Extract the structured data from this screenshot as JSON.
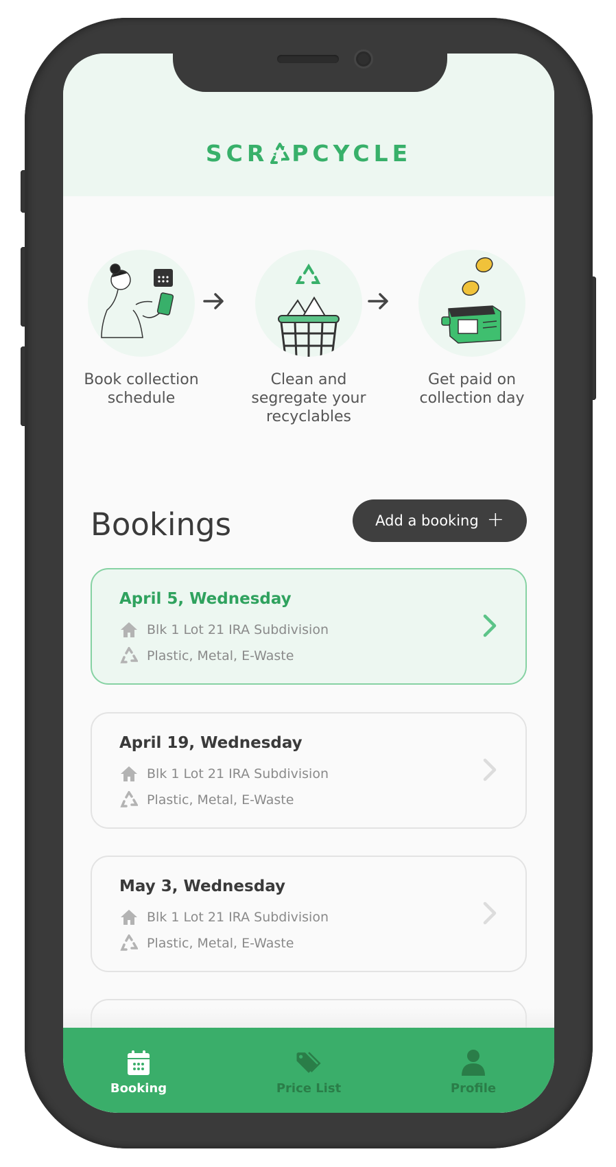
{
  "app": {
    "logo_text_left": "SCR",
    "logo_text_right": "PCYCLE",
    "brand_color": "#3aae6a",
    "header_bg": "#edf7f1"
  },
  "steps": [
    {
      "label": "Book collection schedule",
      "icon": "woman-booking-illustration"
    },
    {
      "label": "Clean and segregate your recyclables",
      "icon": "recycle-basket-illustration"
    },
    {
      "label": "Get paid on collection day",
      "icon": "wallet-coins-illustration"
    }
  ],
  "bookings": {
    "title": "Bookings",
    "add_label": "Add a booking",
    "add_icon": "+",
    "items": [
      {
        "date": "April 5, Wednesday",
        "address": "Blk 1 Lot 21 IRA Subdivision",
        "materials": "Plastic, Metal, E-Waste",
        "active": true
      },
      {
        "date": "April 19, Wednesday",
        "address": "Blk 1 Lot 21 IRA Subdivision",
        "materials": "Plastic, Metal, E-Waste",
        "active": false
      },
      {
        "date": "May 3, Wednesday",
        "address": "Blk 1 Lot 21 IRA Subdivision",
        "materials": "Plastic, Metal, E-Waste",
        "active": false
      }
    ]
  },
  "tabbar": {
    "tabs": [
      {
        "label": "Booking",
        "icon": "calendar-icon",
        "active": true
      },
      {
        "label": "Price List",
        "icon": "price-tag-icon",
        "active": false
      },
      {
        "label": "Profile",
        "icon": "user-icon",
        "active": false
      }
    ]
  }
}
